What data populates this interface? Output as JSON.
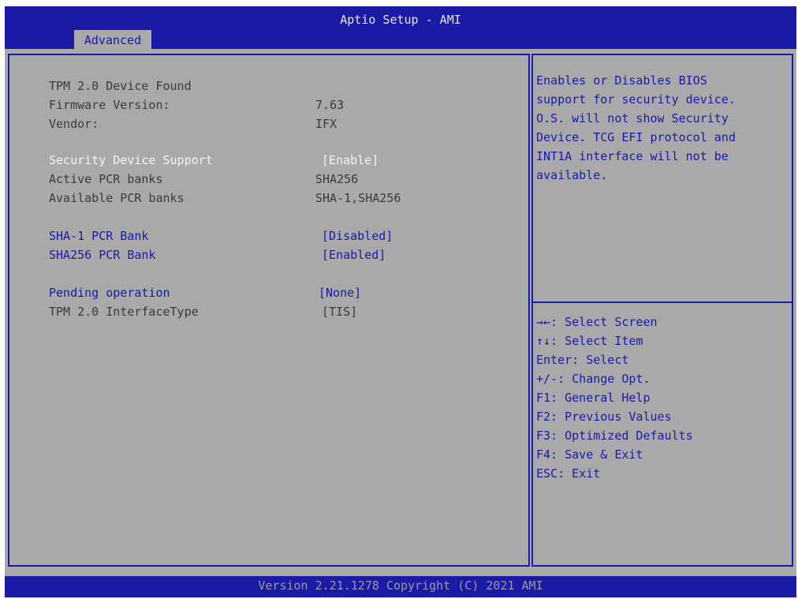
{
  "header": {
    "title": "Aptio Setup - AMI",
    "active_tab": "Advanced"
  },
  "settings": [
    {
      "label": "TPM 2.0 Device Found",
      "value": ""
    },
    {
      "label": "Firmware Version:",
      "value": "7.63"
    },
    {
      "label": "Vendor:",
      "value": "IFX"
    },
    {
      "label": "Security Device Support",
      "value": "[Enable]"
    },
    {
      "label": "Active PCR banks",
      "value": "SHA256"
    },
    {
      "label": "Available PCR banks",
      "value": "SHA-1,SHA256"
    },
    {
      "label": "SHA-1 PCR Bank",
      "value": "[Disabled]"
    },
    {
      "label": "SHA256 PCR Bank",
      "value": "[Enabled]"
    },
    {
      "label": "Pending operation",
      "value": "[None]"
    },
    {
      "label": "TPM 2.0 InterfaceType",
      "value": "[TIS]"
    }
  ],
  "help": {
    "description": "Enables or Disables BIOS\nsupport for security device.\nO.S. will not show Security\nDevice. TCG EFI protocol and\nINT1A interface will not be\navailable."
  },
  "keys": [
    "→←: Select Screen",
    "↑↓: Select Item",
    "Enter: Select",
    "+/-: Change Opt.",
    "F1: General Help",
    "F2: Previous Values",
    "F3: Optimized Defaults",
    "F4: Save & Exit",
    "ESC: Exit"
  ],
  "footer": {
    "version": "Version 2.21.1278 Copyright (C) 2021 AMI"
  },
  "colors": {
    "bios_blue": "#1a1aa6",
    "panel_gray": "#a9a9a9",
    "selected_white": "#f4f4f4"
  }
}
